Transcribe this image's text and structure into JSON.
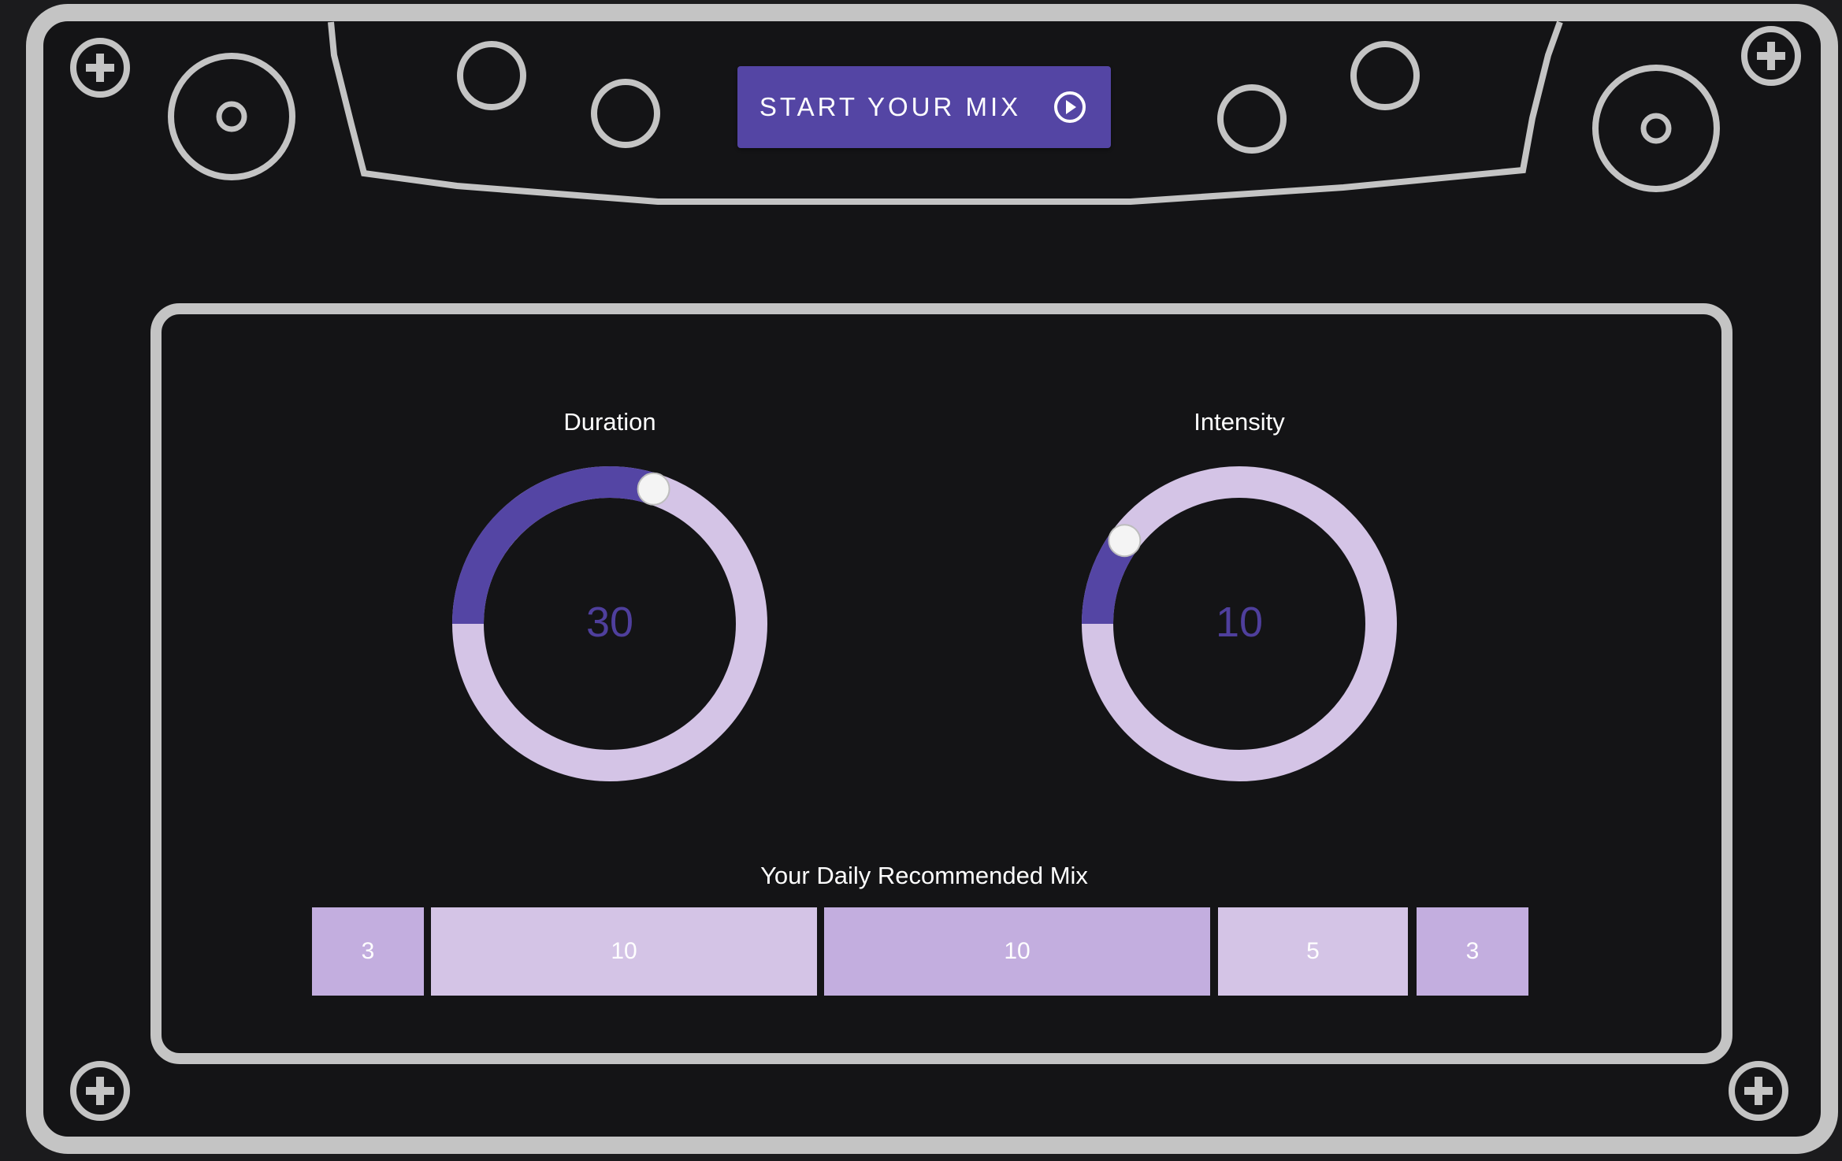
{
  "start_button": {
    "label": "START YOUR MIX",
    "icon": "play-circle-icon"
  },
  "knobs": [
    {
      "title": "Duration",
      "value": "30",
      "fraction": 0.3
    },
    {
      "title": "Intensity",
      "value": "10",
      "fraction": 0.1
    }
  ],
  "mix": {
    "title": "Your Daily Recommended Mix",
    "segments": [
      {
        "value": "3",
        "color": "#c3aedf"
      },
      {
        "value": "10",
        "color": "#d4c4e6"
      },
      {
        "value": "10",
        "color": "#c3aedf"
      },
      {
        "value": "5",
        "color": "#d4c4e6"
      },
      {
        "value": "3",
        "color": "#c3aedf"
      }
    ]
  },
  "colors": {
    "background": "#141416",
    "outline": "#c4c4c4",
    "accent": "#5445a4",
    "track": "#d4c4e6",
    "value_text": "#4f3f9d"
  },
  "icons": [
    "screw-icon",
    "reel-icon",
    "hole-icon",
    "play-circle-icon"
  ]
}
